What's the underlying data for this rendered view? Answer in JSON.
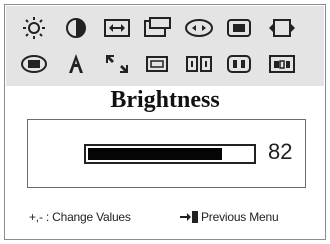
{
  "title": "Brightness",
  "brightness": {
    "value": "82",
    "level": 0.82
  },
  "footer": {
    "change_values": "+,- : Change Values",
    "previous_menu": "Previous Menu"
  },
  "icons": {
    "row1": [
      "brightness-icon",
      "contrast-icon",
      "horizontal-position-icon",
      "vertical-position-icon",
      "zoom-icon",
      "color-icon",
      "reset-icon"
    ],
    "row2": [
      "display-mode-icon",
      "text-graphics-icon",
      "size-icon",
      "moire-icon",
      "degauss-icon",
      "information-icon",
      "osd-timeout-icon"
    ]
  },
  "colors": {
    "panel": "#e4e4e4",
    "bar": "#050505"
  }
}
